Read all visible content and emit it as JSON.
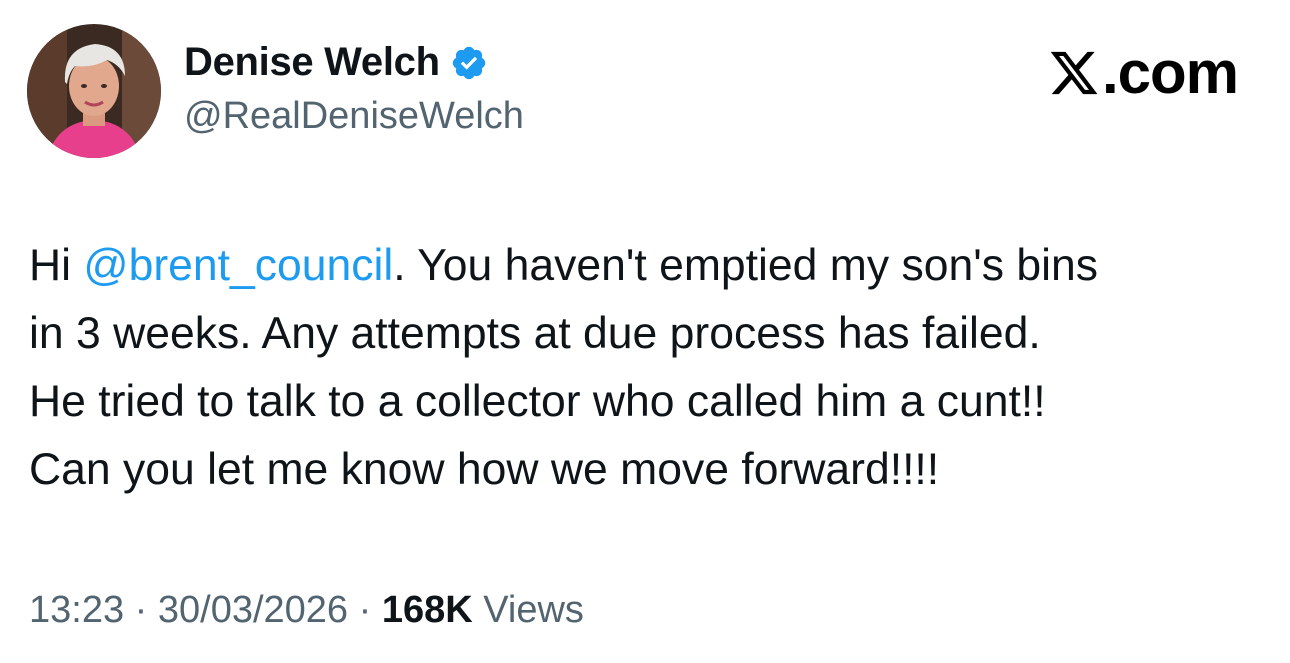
{
  "author": {
    "display_name": "Denise Welch",
    "handle": "@RealDeniseWelch",
    "verified_color": "#1d9bf0"
  },
  "brand": {
    "text": ".com",
    "logo_icon": "x-logo-icon"
  },
  "tweet": {
    "line1_pre": "Hi ",
    "mention": "@brent_council",
    "line1_post": ". You haven't emptied my son's bins",
    "line2": "in 3 weeks. Any attempts at due process has failed.",
    "line3": "He tried to talk to a collector who called him a cunt!!",
    "line4": "Can you let me know how we move forward!!!!"
  },
  "meta": {
    "time": "13:23",
    "separator": " · ",
    "date": "30/03/2026",
    "views_count": "168K",
    "views_label": " Views"
  },
  "colors": {
    "text": "#0f1419",
    "secondary": "#536471",
    "link": "#1d9bf0",
    "background": "#ffffff"
  }
}
